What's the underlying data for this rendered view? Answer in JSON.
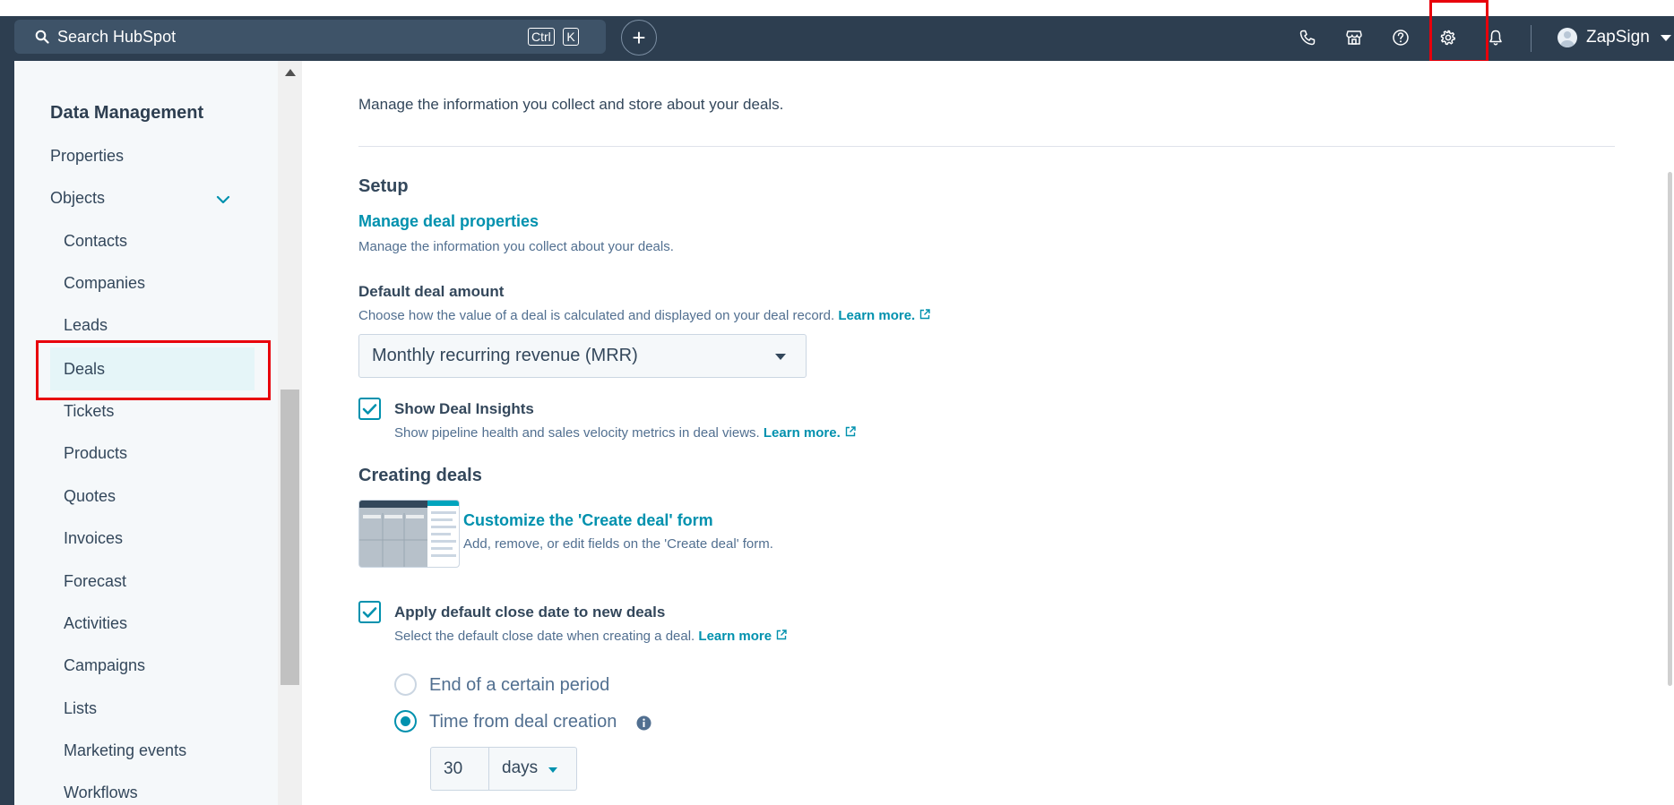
{
  "topnav": {
    "search_placeholder": "Search HubSpot",
    "shortcut_ctrl": "Ctrl",
    "shortcut_k": "K",
    "plus_label": "+",
    "account_name": "ZapSign",
    "icons": [
      "phone-icon",
      "marketplace-icon",
      "help-icon",
      "settings-gear-icon",
      "notifications-bell-icon"
    ]
  },
  "sidebar": {
    "section_title": "Data Management",
    "items": [
      {
        "label": "Properties"
      },
      {
        "label": "Objects"
      },
      {
        "label": "Contacts"
      },
      {
        "label": "Companies"
      },
      {
        "label": "Leads"
      },
      {
        "label": "Deals"
      },
      {
        "label": "Tickets"
      },
      {
        "label": "Products"
      },
      {
        "label": "Quotes"
      },
      {
        "label": "Invoices"
      },
      {
        "label": "Forecast"
      },
      {
        "label": "Activities"
      },
      {
        "label": "Campaigns"
      },
      {
        "label": "Lists"
      },
      {
        "label": "Marketing events"
      },
      {
        "label": "Workflows"
      }
    ],
    "active_item": "Deals"
  },
  "main": {
    "description": "Manage the information you collect and store about your deals.",
    "setup": {
      "heading": "Setup",
      "manage_link": "Manage deal properties",
      "manage_help": "Manage the information you collect about your deals."
    },
    "default_amount": {
      "label": "Default deal amount",
      "help": "Choose how the value of a deal is calculated and displayed on your deal record.",
      "learn_more": "Learn more.",
      "selected_value": "Monthly recurring revenue (MRR)"
    },
    "deal_insights": {
      "checked": true,
      "label": "Show Deal Insights",
      "help": "Show pipeline health and sales velocity metrics in deal views.",
      "learn_more": "Learn more."
    },
    "creating": {
      "heading": "Creating deals",
      "customize_link": "Customize the 'Create deal' form",
      "customize_help": "Add, remove, or edit fields on the 'Create deal' form."
    },
    "close_date": {
      "checked": true,
      "label": "Apply default close date to new deals",
      "help": "Select the default close date when creating a deal.",
      "learn_more": "Learn more",
      "options": [
        {
          "label": "End of a certain period",
          "selected": false
        },
        {
          "label": "Time from deal creation",
          "selected": true
        }
      ],
      "amount_value": "30",
      "unit_value": "days"
    }
  },
  "colors": {
    "nav_bg": "#2d3e50",
    "accent": "#0091ae",
    "highlight": "#e8000b"
  }
}
